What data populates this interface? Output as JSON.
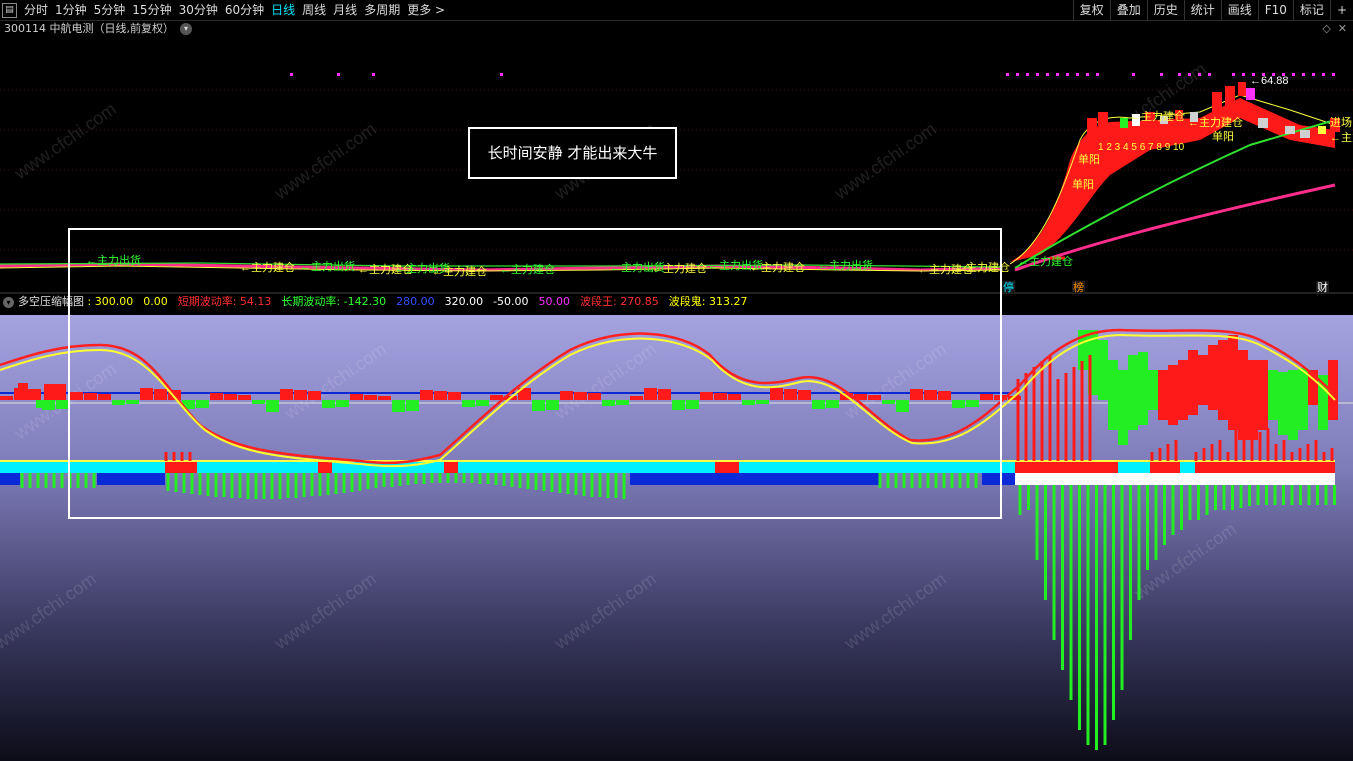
{
  "toolbar": {
    "menu_icon": "menu-icon",
    "timeframes": [
      "分时",
      "1分钟",
      "5分钟",
      "15分钟",
      "30分钟",
      "60分钟",
      "日线",
      "周线",
      "月线",
      "多周期",
      "更多 >"
    ],
    "active_timeframe": "日线",
    "right_tools": [
      "复权",
      "叠加",
      "历史",
      "统计",
      "画线",
      "F10",
      "标记",
      "+"
    ]
  },
  "stock": {
    "title": "300114 中航电测（日线,前复权）"
  },
  "price_chart": {
    "annotation_box": "长时间安静 才能出来大牛",
    "peak_price": "64.88",
    "signal_main_build": "主力建仓",
    "signal_main_out": "主力出货",
    "signal_single_yang": "单阳",
    "signal_enter": "进场",
    "sequence_numbers": "1 2 3 4 5 6 7 8 9 10",
    "axis_markers": [
      "停",
      "榜",
      "财"
    ]
  },
  "indicator": {
    "name": "多空压缩幅图",
    "values": [
      {
        "label": "",
        "value": "300.00",
        "color": "#ffff00"
      },
      {
        "label": "",
        "value": "0.00",
        "color": "#ffff00"
      },
      {
        "label": "短期波动率:",
        "value": "54.13",
        "color": "#ff3030"
      },
      {
        "label": "长期波动率:",
        "value": "-142.30",
        "color": "#30ff30"
      },
      {
        "label": "",
        "value": "280.00",
        "color": "#3050ff"
      },
      {
        "label": "",
        "value": "320.00",
        "color": "#ffffff"
      },
      {
        "label": "",
        "value": "-50.00",
        "color": "#ffffff"
      },
      {
        "label": "",
        "value": "50.00",
        "color": "#ff30ff"
      },
      {
        "label": "波段王:",
        "value": "270.85",
        "color": "#ff3030"
      },
      {
        "label": "波段鬼:",
        "value": "313.27",
        "color": "#ffff00"
      }
    ]
  },
  "colors": {
    "up": "#ff1a1a",
    "down": "#22ee22",
    "ma_yellow": "#ffff40",
    "ma_green": "#30e030",
    "ma_pink": "#ff2d8c",
    "bar_cyan": "#00f0ff",
    "bar_blue": "#0a2ad8",
    "accent": "#00e5ff"
  },
  "watermark": "www.cfchi.com"
}
